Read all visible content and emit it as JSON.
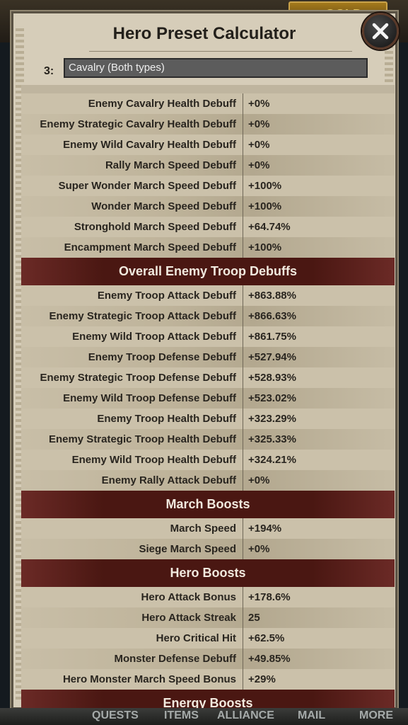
{
  "header": {
    "title": "Hero Preset Calculator",
    "gold_label": "GOLD",
    "preset_number": "3:",
    "preset_value": "Cavalry (Both types)"
  },
  "rows_a": [
    {
      "label": "Enemy Cavalry Health Debuff",
      "value": "+0%"
    },
    {
      "label": "Enemy Strategic Cavalry Health Debuff",
      "value": "+0%"
    },
    {
      "label": "Enemy Wild Cavalry Health Debuff",
      "value": "+0%"
    },
    {
      "label": "Rally March Speed Debuff",
      "value": "+0%"
    },
    {
      "label": "Super Wonder March Speed Debuff",
      "value": "+100%"
    },
    {
      "label": "Wonder March Speed Debuff",
      "value": "+100%"
    },
    {
      "label": "Stronghold March Speed Debuff",
      "value": "+64.74%"
    },
    {
      "label": "Encampment March Speed Debuff",
      "value": "+100%"
    }
  ],
  "section_troop": "Overall Enemy Troop Debuffs",
  "rows_b": [
    {
      "label": "Enemy Troop Attack Debuff",
      "value": "+863.88%"
    },
    {
      "label": "Enemy Strategic Troop Attack Debuff",
      "value": "+866.63%"
    },
    {
      "label": "Enemy Wild Troop Attack Debuff",
      "value": "+861.75%"
    },
    {
      "label": "Enemy Troop Defense Debuff",
      "value": "+527.94%"
    },
    {
      "label": "Enemy Strategic Troop Defense Debuff",
      "value": "+528.93%"
    },
    {
      "label": "Enemy Wild Troop Defense Debuff",
      "value": "+523.02%"
    },
    {
      "label": "Enemy Troop Health Debuff",
      "value": "+323.29%"
    },
    {
      "label": "Enemy Strategic Troop Health Debuff",
      "value": "+325.33%"
    },
    {
      "label": "Enemy Wild Troop Health Debuff",
      "value": "+324.21%"
    },
    {
      "label": "Enemy Rally Attack Debuff",
      "value": "+0%"
    }
  ],
  "section_march": "March Boosts",
  "rows_c": [
    {
      "label": "March Speed",
      "value": "+194%"
    },
    {
      "label": "Siege March Speed",
      "value": "+0%"
    }
  ],
  "section_hero": "Hero Boosts",
  "rows_d": [
    {
      "label": "Hero Attack Bonus",
      "value": "+178.6%"
    },
    {
      "label": "Hero Attack Streak",
      "value": "25"
    },
    {
      "label": "Hero Critical Hit",
      "value": "+62.5%"
    },
    {
      "label": "Monster Defense Debuff",
      "value": "+49.85%"
    },
    {
      "label": "Hero Monster March Speed Bonus",
      "value": "+29%"
    }
  ],
  "section_energy": "Energy Boosts",
  "bottom_nav": [
    "QUESTS",
    "ITEMS",
    "ALLIANCE",
    "MAIL",
    "MORE"
  ],
  "icons": {
    "close": "close-icon"
  },
  "colors": {
    "section_header": "#4a1712",
    "parchment": "#d6cdb9"
  }
}
